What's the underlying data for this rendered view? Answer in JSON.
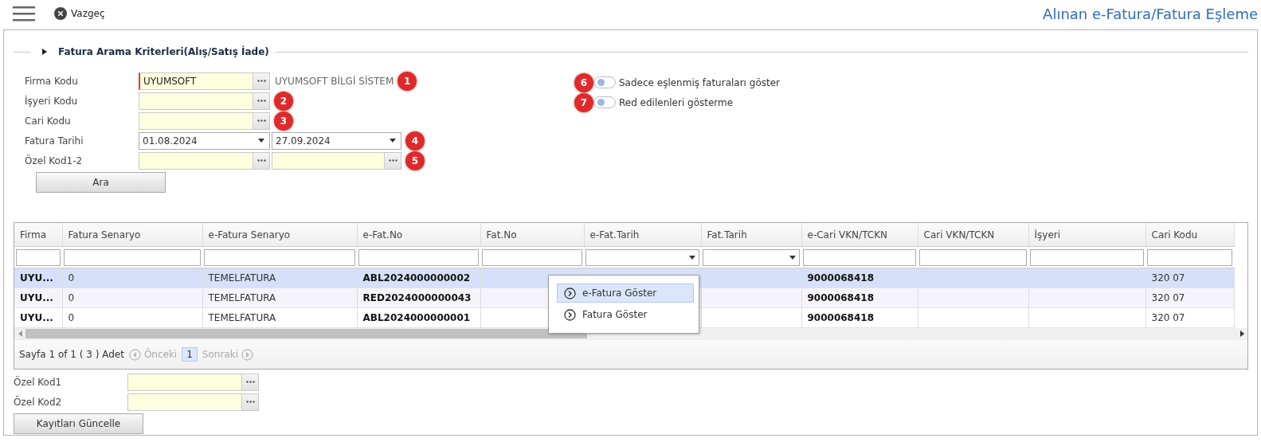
{
  "toolbar": {
    "cancel": "Vazgeç",
    "title": "Alınan e-Fatura/Fatura Eşleme"
  },
  "criteria": {
    "legend": "Fatura Arama Kriterleri(Alış/Satış İade)",
    "fields": [
      {
        "label": "Firma Kodu",
        "kind": "lookup",
        "value": "UYUMSOFT",
        "required": true,
        "description": "UYUMSOFT BİLGİ SİSTEM",
        "badge": "1"
      },
      {
        "label": "İşyeri Kodu",
        "kind": "lookup",
        "required": false,
        "badge": "2"
      },
      {
        "label": "Cari Kodu",
        "kind": "lookup",
        "required": false,
        "badge": "3"
      },
      {
        "label": "Fatura Tarihi",
        "kind": "date-range",
        "from": "01.08.2024",
        "to": "27.09.2024",
        "badge": "4"
      },
      {
        "label": "Özel Kod1-2",
        "kind": "lookup-pair",
        "badge": "5"
      }
    ],
    "search_button": "Ara",
    "toggles": [
      {
        "badge": "6",
        "label": "Sadece eşlenmiş faturaları göster",
        "on": false
      },
      {
        "badge": "7",
        "label": "Red edilenleri gösterme",
        "on": false
      }
    ]
  },
  "table": {
    "columns": [
      {
        "label": "Firma",
        "kind": "textfilter"
      },
      {
        "label": "Fatura Senaryo",
        "kind": "textfilter"
      },
      {
        "label": "e-Fatura Senaryo",
        "kind": "textfilter"
      },
      {
        "label": "e-Fat.No",
        "kind": "textfilter"
      },
      {
        "label": "Fat.No",
        "kind": "textfilter"
      },
      {
        "label": "e-Fat.Tarih",
        "kind": "selectfilter"
      },
      {
        "label": "Fat.Tarih",
        "kind": "selectfilter"
      },
      {
        "label": "e-Cari VKN/TCKN",
        "kind": "textfilter"
      },
      {
        "label": "Cari VKN/TCKN",
        "kind": "textfilter"
      },
      {
        "label": "İşyeri",
        "kind": "textfilter"
      },
      {
        "label": "Cari Kodu",
        "kind": "textfilter"
      }
    ],
    "rows": [
      {
        "selected": true,
        "cells": [
          "UYU...",
          "0",
          "TEMELFATURA",
          "ABL2024000000002",
          null,
          null,
          null,
          "9000068418",
          null,
          null,
          "320 07"
        ]
      },
      {
        "selected": false,
        "cells": [
          "UYU...",
          "0",
          "TEMELFATURA",
          "RED2024000000043",
          null,
          null,
          null,
          "9000068418",
          null,
          null,
          "320 07"
        ]
      },
      {
        "selected": false,
        "cells": [
          "UYU...",
          "0",
          "TEMELFATURA",
          "ABL2024000000001",
          null,
          null,
          null,
          "9000068418",
          null,
          null,
          "320 07"
        ]
      }
    ],
    "context_menu": [
      {
        "label": "e-Fatura Göster",
        "selected": true
      },
      {
        "label": "Fatura Göster",
        "selected": false
      }
    ],
    "pager": {
      "summary": "Sayfa 1 of 1 ( 3 ) Adet",
      "previous": "Önceki",
      "page": "1",
      "next": "Sonraki"
    }
  },
  "bottom": {
    "fields": [
      {
        "label": "Özel Kod1"
      },
      {
        "label": "Özel Kod2"
      }
    ],
    "update_button": "Kayıtları Güncelle"
  }
}
